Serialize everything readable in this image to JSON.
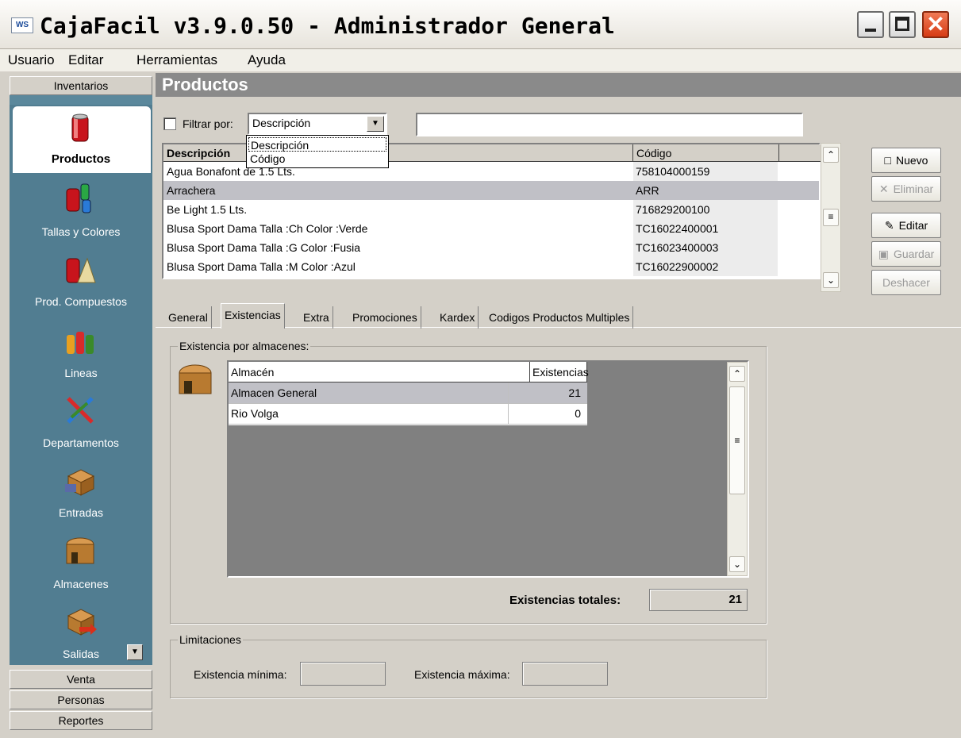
{
  "window": {
    "title": "CajaFacil v3.9.0.50 - Administrador General",
    "icon_text": "WS",
    "controls": [
      "minimize-icon",
      "maximize-icon",
      "close-icon"
    ],
    "close_glyph": "✕"
  },
  "menu": [
    "Usuario",
    "Editar",
    "Herramientas",
    "Ayuda"
  ],
  "sidebar": {
    "top_header": "Inventarios",
    "items": [
      {
        "label": "Productos",
        "icon": "can-icon"
      },
      {
        "label": "Tallas y Colores",
        "icon": "cans-icon"
      },
      {
        "label": "Prod. Compuestos",
        "icon": "can-cheese-icon"
      },
      {
        "label": "Lineas",
        "icon": "bottles-icon"
      },
      {
        "label": "Departamentos",
        "icon": "tools-icon"
      },
      {
        "label": "Entradas",
        "icon": "box-in-icon"
      },
      {
        "label": "Almacenes",
        "icon": "warehouse-icon"
      },
      {
        "label": "Salidas",
        "icon": "box-out-icon"
      }
    ],
    "bottom_headers": [
      "Venta",
      "Personas",
      "Reportes"
    ],
    "scroll_glyph": "▼"
  },
  "page": {
    "title": "Productos"
  },
  "filter": {
    "label": "Filtrar por:",
    "selected": "Descripción",
    "options": [
      "Descripción",
      "Código"
    ],
    "search_value": "",
    "combo_glyph": "▼"
  },
  "products": {
    "columns": [
      "Descripción",
      "Código"
    ],
    "rows": [
      {
        "descripcion": "Agua Bonafont de 1.5 Lts.",
        "codigo": "758104000159"
      },
      {
        "descripcion": "Arrachera",
        "codigo": "ARR",
        "selected": true
      },
      {
        "descripcion": "Be Light 1.5 Lts.",
        "codigo": "716829200100"
      },
      {
        "descripcion": "Blusa Sport Dama Talla :Ch Color :Verde",
        "codigo": "TC16022400001"
      },
      {
        "descripcion": "Blusa Sport Dama Talla :G Color :Fusia",
        "codigo": "TC16023400003"
      },
      {
        "descripcion": "Blusa Sport Dama Talla :M Color :Azul",
        "codigo": "TC16022900002"
      }
    ],
    "scroll_glyphs": {
      "up": "⌃",
      "grip": "≡",
      "down": "⌄"
    }
  },
  "actions": {
    "nuevo": "Nuevo",
    "eliminar": "Eliminar",
    "editar": "Editar",
    "guardar": "Guardar",
    "deshacer": "Deshacer",
    "icons": {
      "nuevo": "□",
      "eliminar": "✕",
      "editar": "✎",
      "guardar": "▣"
    }
  },
  "tabs": [
    "General",
    "Existencias",
    "Extra",
    "Promociones",
    "Kardex",
    "Codigos Productos Multiples"
  ],
  "active_tab": "Existencias",
  "existencias": {
    "group_label": "Existencia por almacenes:",
    "columns": [
      "Almacén",
      "Existencias"
    ],
    "rows": [
      {
        "almacen": "Almacen General",
        "existencias": "21",
        "selected": true
      },
      {
        "almacen": "Rio Volga",
        "existencias": "0"
      }
    ],
    "total_label": "Existencias totales:",
    "total_value": "21"
  },
  "limitaciones": {
    "group_label": "Limitaciones",
    "min_label": "Existencia mínima:",
    "min_value": "",
    "max_label": "Existencia máxima:",
    "max_value": ""
  }
}
